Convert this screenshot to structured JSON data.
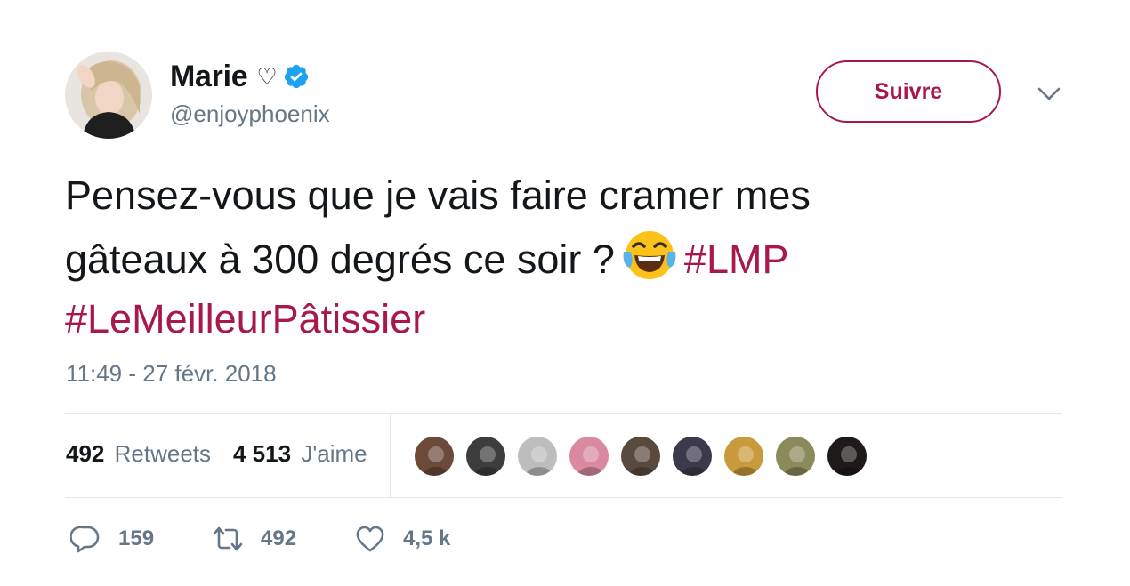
{
  "user": {
    "display_name": "Marie",
    "name_suffix": "♡",
    "handle": "@enjoyphoenix",
    "verified": true
  },
  "follow_button": {
    "label": "Suivre"
  },
  "tweet": {
    "line1": "Pensez-vous que je vais faire cramer mes",
    "line2": "gâteaux à 300 degrés ce soir ?",
    "emoji": "face-with-tears-of-joy",
    "hashtag1": "#LMP",
    "hashtag2": "#LeMeilleurPâtissier"
  },
  "timestamp": "11:49 - 27 févr. 2018",
  "stats": {
    "retweets_count": "492",
    "retweets_label": "Retweets",
    "likes_count": "4 513",
    "likes_label": "J'aime"
  },
  "likers": [
    {
      "color": "#6b4a3a"
    },
    {
      "color": "#3d3d3d"
    },
    {
      "color": "#bdbdbd"
    },
    {
      "color": "#d98aa0"
    },
    {
      "color": "#5a4a3e"
    },
    {
      "color": "#3b3a4a"
    },
    {
      "color": "#c99a3c"
    },
    {
      "color": "#8a8a5a"
    },
    {
      "color": "#1e1a1a"
    }
  ],
  "actions": {
    "reply_count": "159",
    "retweet_count": "492",
    "like_count": "4,5 k"
  },
  "colors": {
    "accent": "#a8194a",
    "verified": "#1da1f2",
    "muted": "#657786",
    "divider": "#e1e8ed"
  }
}
